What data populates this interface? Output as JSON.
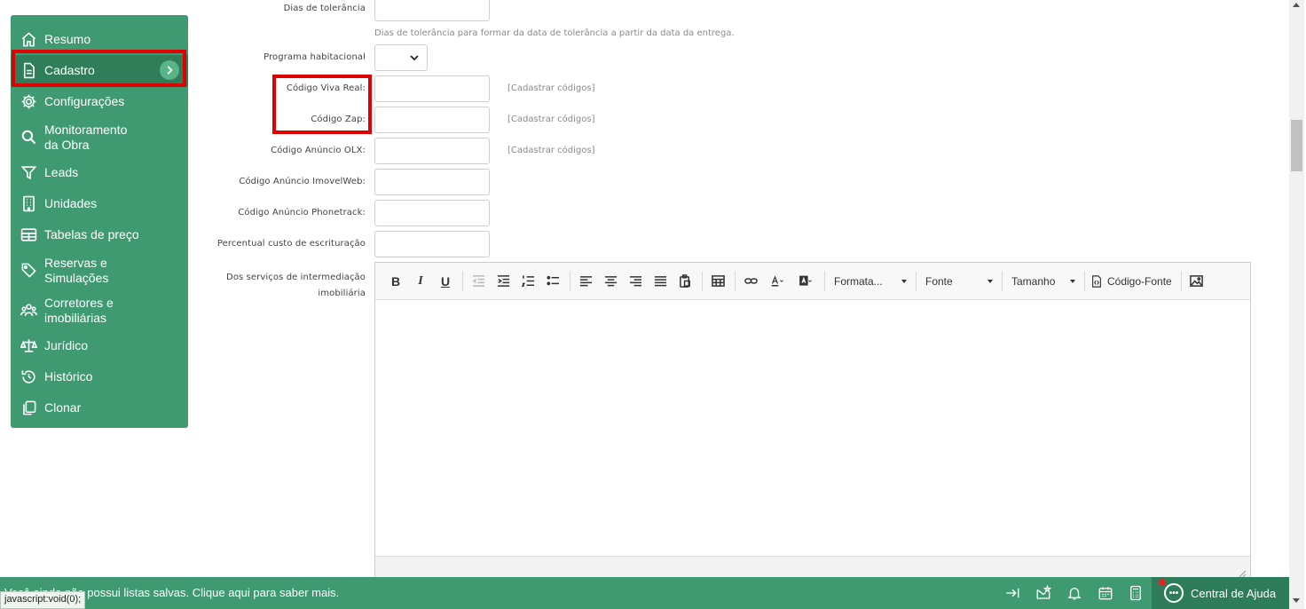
{
  "sidebar": {
    "items": [
      {
        "label": "Resumo",
        "icon": "home-icon"
      },
      {
        "label": "Cadastro",
        "icon": "document-icon"
      },
      {
        "label": "Configurações",
        "icon": "gear-icon"
      },
      {
        "label": "Monitoramento\nda Obra",
        "icon": "search-icon"
      },
      {
        "label": "Leads",
        "icon": "filter-icon"
      },
      {
        "label": "Unidades",
        "icon": "building-icon"
      },
      {
        "label": "Tabelas de preço",
        "icon": "table-icon"
      },
      {
        "label": "Reservas e\nSimulações",
        "icon": "tag-icon"
      },
      {
        "label": "Corretores e\nimobiliárias",
        "icon": "people-icon"
      },
      {
        "label": "Jurídico",
        "icon": "scale-icon"
      },
      {
        "label": "Histórico",
        "icon": "history-icon"
      },
      {
        "label": "Clonar",
        "icon": "copy-icon"
      }
    ]
  },
  "form": {
    "dias_tolerancia": {
      "label": "Dias de tolerância",
      "value": "",
      "help": "Dias de tolerância para formar da data de tolerância a partir da data da entrega."
    },
    "programa_habitacional": {
      "label": "Programa habitacional",
      "selected": ""
    },
    "codigo_viva_real": {
      "label": "Código Viva Real:",
      "value": "",
      "link": "[Cadastrar códigos]"
    },
    "codigo_zap": {
      "label": "Código Zap:",
      "value": "",
      "link": "[Cadastrar códigos]"
    },
    "codigo_olx": {
      "label": "Código Anúncio OLX:",
      "value": "",
      "link": "[Cadastrar códigos]"
    },
    "codigo_imovelweb": {
      "label": "Código Anúncio ImovelWeb:",
      "value": ""
    },
    "codigo_phonetrack": {
      "label": "Código Anúncio Phonetrack:",
      "value": ""
    },
    "percentual_custo": {
      "label": "Percentual custo de escrituração",
      "value": ""
    },
    "servicos_intermediacao": {
      "label": "Dos serviços de intermediação imobiliária"
    }
  },
  "editor": {
    "bold": "B",
    "italic": "I",
    "underline": "U",
    "format_label": "Formata...",
    "font_label": "Fonte",
    "size_label": "Tamanho",
    "source_label": "Código-Fonte"
  },
  "bottombar": {
    "message": "Você ainda não possui listas salvas. Clique aqui para saber mais.",
    "status_tip": "javascript:void(0);",
    "help_center": "Central de Ajuda"
  },
  "colors": {
    "sidebar": "#3f9a72",
    "sidebar_active": "#2f7e59",
    "highlight": "#e00000"
  }
}
